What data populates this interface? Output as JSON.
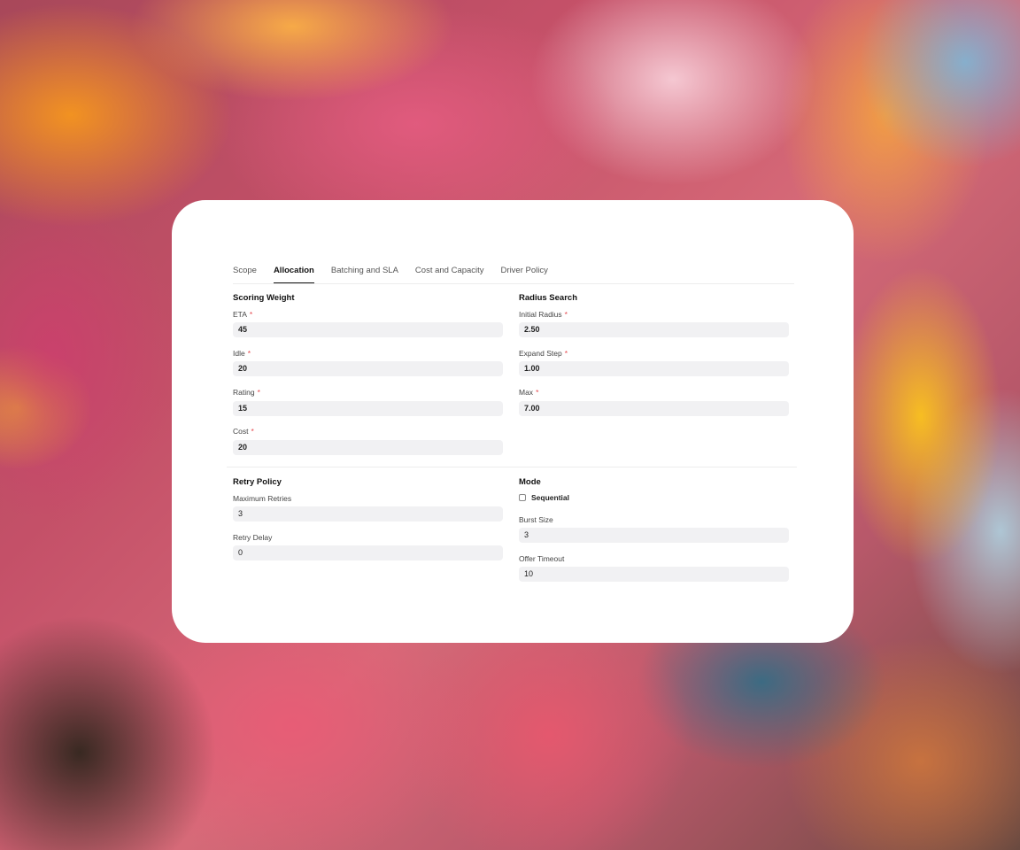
{
  "tabs": [
    {
      "label": "Scope",
      "active": false
    },
    {
      "label": "Allocation",
      "active": true
    },
    {
      "label": "Batching and SLA",
      "active": false
    },
    {
      "label": "Cost and Capacity",
      "active": false
    },
    {
      "label": "Driver Policy",
      "active": false
    }
  ],
  "scoring_weight": {
    "title": "Scoring Weight",
    "eta": {
      "label": "ETA",
      "value": "45"
    },
    "idle": {
      "label": "Idle",
      "value": "20"
    },
    "rating": {
      "label": "Rating",
      "value": "15"
    },
    "cost": {
      "label": "Cost",
      "value": "20"
    }
  },
  "radius_search": {
    "title": "Radius Search",
    "initial_radius": {
      "label": "Initial Radius",
      "value": "2.50"
    },
    "expand_step": {
      "label": "Expand Step",
      "value": "1.00"
    },
    "max": {
      "label": "Max",
      "value": "7.00"
    }
  },
  "retry_policy": {
    "title": "Retry Policy",
    "maximum_retries": {
      "label": "Maximum Retries",
      "value": "3"
    },
    "retry_delay": {
      "label": "Retry Delay",
      "value": "0"
    }
  },
  "mode": {
    "title": "Mode",
    "sequential": {
      "label": "Sequential",
      "checked": false
    },
    "burst_size": {
      "label": "Burst Size",
      "value": "3"
    },
    "offer_timeout": {
      "label": "Offer Timeout",
      "value": "10"
    }
  },
  "required_marker": "*",
  "colors": {
    "required": "#e5484d",
    "input_bg": "#f1f1f3",
    "active_tab": "#111111"
  }
}
